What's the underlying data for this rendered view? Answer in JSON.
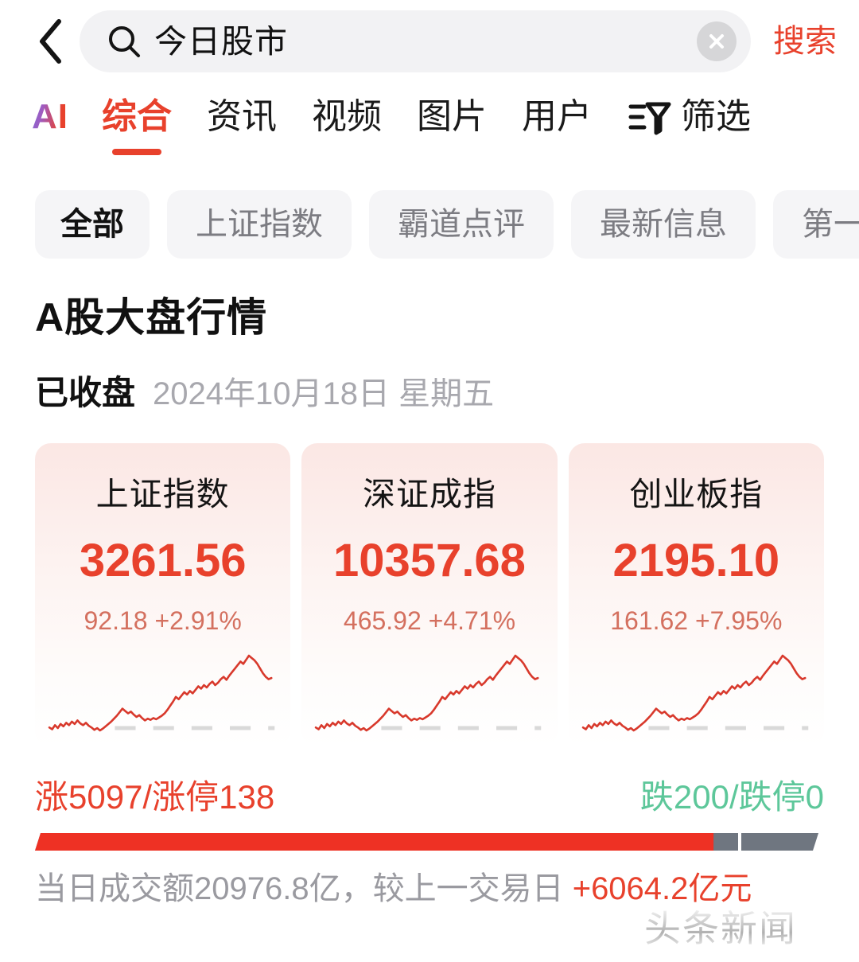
{
  "search": {
    "back_label": "返回",
    "query": "今日股市",
    "placeholder": "搜索",
    "clear_label": "清除",
    "submit_label": "搜索"
  },
  "tabs": {
    "ai_label": "AI",
    "items": [
      {
        "label": "综合",
        "active": true
      },
      {
        "label": "资讯",
        "active": false
      },
      {
        "label": "视频",
        "active": false
      },
      {
        "label": "图片",
        "active": false
      },
      {
        "label": "用户",
        "active": false
      }
    ],
    "filter_label": "筛选"
  },
  "chips": [
    {
      "label": "全部",
      "active": true
    },
    {
      "label": "上证指数",
      "active": false
    },
    {
      "label": "霸道点评",
      "active": false
    },
    {
      "label": "最新信息",
      "active": false
    },
    {
      "label": "第一",
      "active": false
    }
  ],
  "market": {
    "title": "A股大盘行情",
    "status": "已收盘",
    "date": "2024年10月18日 星期五",
    "cards": [
      {
        "name": "上证指数",
        "value": "3261.56",
        "change": "92.18 +2.91%"
      },
      {
        "name": "深证成指",
        "value": "10357.68",
        "change": "465.92 +4.71%"
      },
      {
        "name": "创业板指",
        "value": "2195.10",
        "change": "161.62 +7.95%"
      }
    ],
    "breadth": {
      "up_text": "涨5097/涨停138",
      "down_text": "跌200/跌停0",
      "up_ratio": 0.86
    },
    "turnover_text": "当日成交额20976.8亿，较上一交易日 ",
    "turnover_delta": "+6064.2亿元"
  },
  "watermark": {
    "text": "头条新闻"
  },
  "colors": {
    "accent_red": "#E8412C",
    "down_green": "#5DC79A",
    "muted_red": "#D4705F",
    "gray_text": "#9A9AA0",
    "chip_bg": "#F5F5F7",
    "search_bg": "#F2F2F4"
  },
  "chart_data": [
    {
      "type": "line",
      "title": "上证指数",
      "ylabel": "",
      "xlabel": "",
      "grid": false,
      "legend": "none",
      "annotations": [
        "dashed baseline"
      ],
      "values": [
        18,
        15,
        22,
        17,
        24,
        20,
        26,
        22,
        28,
        24,
        30,
        25,
        22,
        26,
        21,
        18,
        14,
        17,
        13,
        16,
        20,
        24,
        28,
        33,
        38,
        44,
        50,
        46,
        42,
        45,
        40,
        36,
        39,
        34,
        30,
        33,
        31,
        34,
        32,
        35,
        38,
        42,
        48,
        55,
        62,
        70,
        66,
        72,
        78,
        74,
        80,
        76,
        82,
        88,
        84,
        90,
        86,
        92,
        96,
        90,
        94,
        100,
        104,
        99,
        106,
        112,
        118,
        124,
        130,
        126,
        133,
        140,
        136,
        132,
        126,
        118,
        110,
        104,
        100,
        102
      ]
    },
    {
      "type": "line",
      "title": "深证成指",
      "ylabel": "",
      "xlabel": "",
      "grid": false,
      "legend": "none",
      "annotations": [
        "dashed baseline"
      ],
      "values": [
        16,
        13,
        20,
        15,
        22,
        18,
        24,
        20,
        26,
        22,
        28,
        23,
        20,
        24,
        19,
        16,
        12,
        15,
        11,
        14,
        18,
        22,
        26,
        31,
        36,
        42,
        48,
        44,
        40,
        43,
        38,
        34,
        37,
        32,
        28,
        31,
        29,
        32,
        30,
        33,
        36,
        40,
        46,
        53,
        60,
        68,
        64,
        70,
        76,
        72,
        78,
        74,
        80,
        86,
        82,
        88,
        84,
        90,
        94,
        88,
        92,
        98,
        102,
        97,
        104,
        110,
        116,
        122,
        128,
        124,
        131,
        138,
        134,
        130,
        124,
        116,
        108,
        102,
        98,
        100
      ]
    },
    {
      "type": "line",
      "title": "创业板指",
      "ylabel": "",
      "xlabel": "",
      "grid": false,
      "legend": "none",
      "annotations": [
        "dashed baseline"
      ],
      "values": [
        17,
        14,
        21,
        16,
        23,
        19,
        25,
        21,
        27,
        23,
        29,
        24,
        21,
        25,
        20,
        17,
        13,
        16,
        12,
        15,
        19,
        23,
        27,
        32,
        37,
        43,
        49,
        45,
        41,
        44,
        39,
        35,
        38,
        33,
        29,
        32,
        30,
        33,
        31,
        34,
        37,
        41,
        47,
        54,
        61,
        69,
        65,
        71,
        77,
        73,
        79,
        75,
        81,
        87,
        83,
        89,
        85,
        91,
        95,
        89,
        93,
        99,
        103,
        98,
        105,
        111,
        117,
        123,
        129,
        125,
        132,
        139,
        135,
        131,
        125,
        117,
        109,
        103,
        99,
        101
      ]
    }
  ]
}
